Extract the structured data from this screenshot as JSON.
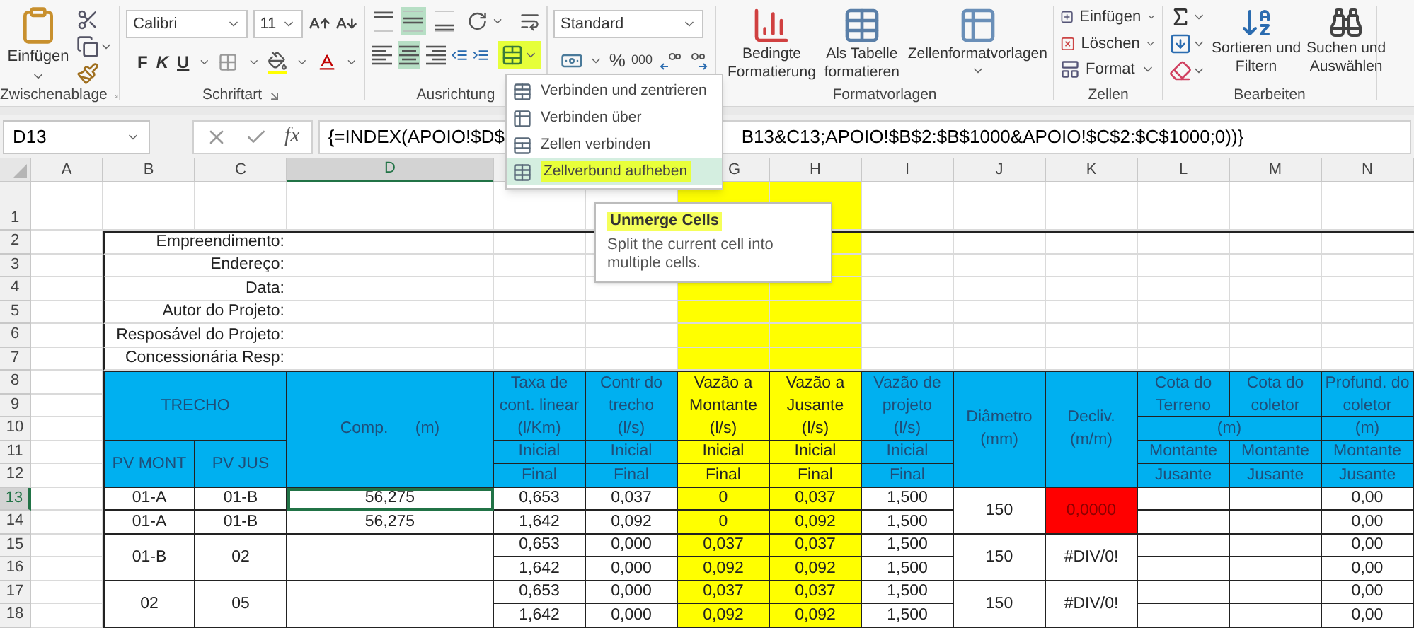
{
  "ribbon": {
    "clipboard": {
      "paste_label": "Einfügen",
      "group_label": "Zwischenablage"
    },
    "font": {
      "font_name": "Calibri",
      "font_size": "11",
      "style_buttons": [
        "F",
        "K",
        "U"
      ],
      "group_label": "Schriftart"
    },
    "alignment": {
      "vertical_align": [
        {
          "selected": false
        },
        {
          "selected": true
        },
        {
          "selected": false
        }
      ],
      "horizontal_align": [
        {
          "selected": false
        },
        {
          "selected": true
        },
        {
          "selected": false
        }
      ],
      "merge_highlighted": true,
      "group_label": "Ausrichtung"
    },
    "number": {
      "format": "Standard",
      "percent": "%",
      "thousands": "000"
    },
    "styles": {
      "buttons": [
        "Bedingte\nFormatierung",
        "Als Tabelle\nformatieren",
        "Zellenformatvorlagen"
      ],
      "group_label": "Formatvorlagen"
    },
    "cells": {
      "buttons": [
        "Einfügen",
        "Löschen",
        "Format"
      ],
      "group_label": "Zellen"
    },
    "editing": {
      "buttons": [
        "Sortieren und\nFiltern",
        "Suchen und\nAuswählen"
      ],
      "group_label": "Bearbeiten"
    }
  },
  "merge_menu": {
    "items": [
      {
        "label": "Verbinden und zentrieren",
        "selected": false
      },
      {
        "label": "Verbinden über",
        "selected": false
      },
      {
        "label": "Zellen verbinden",
        "selected": false
      },
      {
        "label": "Zellverbund aufheben",
        "selected": true
      }
    ]
  },
  "tooltip": {
    "title": "Unmerge Cells",
    "text": "Split the current cell into multiple cells."
  },
  "formula_bar": {
    "name_box": "D13",
    "fx": "fx",
    "formula_start": "{=INDEX(APOIO!$D$",
    "formula_end": "B13&C13;APOIO!$B$2:$B$1000&APOIO!$C$2:$C$1000;0))}"
  },
  "column_headers": [
    {
      "label": "A",
      "selected": false
    },
    {
      "label": "B",
      "selected": false
    },
    {
      "label": "C",
      "selected": false
    },
    {
      "label": "D",
      "selected": true
    },
    {
      "label": "G",
      "selected": false
    },
    {
      "label": "H",
      "selected": false
    },
    {
      "label": "I",
      "selected": false
    },
    {
      "label": "J",
      "selected": false
    },
    {
      "label": "K",
      "selected": false
    },
    {
      "label": "L",
      "selected": false
    },
    {
      "label": "M",
      "selected": false
    },
    {
      "label": "N",
      "selected": false
    }
  ],
  "row_headers": [
    {
      "label": "1",
      "selected": false
    },
    {
      "label": "2",
      "selected": false
    },
    {
      "label": "3",
      "selected": false
    },
    {
      "label": "4",
      "selected": false
    },
    {
      "label": "5",
      "selected": false
    },
    {
      "label": "6",
      "selected": false
    },
    {
      "label": "7",
      "selected": false
    },
    {
      "label": "8",
      "selected": false
    },
    {
      "label": "9",
      "selected": false
    },
    {
      "label": "10",
      "selected": false
    },
    {
      "label": "11",
      "selected": false
    },
    {
      "label": "12",
      "selected": false
    },
    {
      "label": "13",
      "selected": true
    },
    {
      "label": "14",
      "selected": false
    },
    {
      "label": "15",
      "selected": false
    },
    {
      "label": "16",
      "selected": false
    },
    {
      "label": "17",
      "selected": false
    },
    {
      "label": "18",
      "selected": false
    }
  ],
  "info_labels": [
    "Empreendimento:",
    "Endereço:",
    "Data:",
    "Autor do Projeto:",
    "Resposável do Projeto:",
    "Concessionária Resp:"
  ],
  "table_header": {
    "trecho": "TRECHO",
    "pv_mont": "PV MONT",
    "pv_jus": "PV JUS",
    "comp": "Comp.      (m)",
    "flow_columns": [
      {
        "title": "Taxa de\ncont. linear\n(l/Km)",
        "initial": "Inicial",
        "final": "Final",
        "highlighted": false
      },
      {
        "title": "Contr do\ntrecho\n(l/s)",
        "initial": "Inicial",
        "final": "Final",
        "highlighted": false
      },
      {
        "title": "Vazão a\nMontante\n(l/s)",
        "initial": "Inicial",
        "final": "Final",
        "highlighted": true
      },
      {
        "title": "Vazão a\nJusante\n(l/s)",
        "initial": "Inicial",
        "final": "Final",
        "highlighted": true
      },
      {
        "title": "Vazão de\nprojeto\n(l/s)",
        "initial": "Inicial",
        "final": "Final",
        "highlighted": false
      }
    ],
    "diametro": "Diâmetro\n(mm)",
    "decliv": "Decliv.\n(m/m)",
    "unit_shared": "(m)",
    "unit_depth": "(m)",
    "levels": [
      {
        "title": "Cota do\nTerreno",
        "top": "Montante",
        "bottom": "Jusante"
      },
      {
        "title": "Cota do\ncoletor",
        "top": "Montante",
        "bottom": "Jusante"
      },
      {
        "title": "Profund. do\ncoletor",
        "top": "Montante",
        "bottom": "Jusante"
      }
    ]
  },
  "sections": [
    {
      "kind": "split",
      "diametro": "150",
      "decliv": "0,0000",
      "alert": true,
      "lines": [
        {
          "pv_mont": "01-A",
          "pv_jus": "01-B",
          "comp": "56,275",
          "values": [
            "0,653",
            "0,037",
            "0",
            "0,037",
            "1,500"
          ],
          "profund": "0,00"
        },
        {
          "pv_mont": "01-A",
          "pv_jus": "01-B",
          "comp": "56,275",
          "values": [
            "1,642",
            "0,092",
            "0",
            "0,092",
            "1,500"
          ],
          "profund": "0,00"
        }
      ]
    },
    {
      "kind": "merged",
      "pv_mont": "01-B",
      "pv_jus": "02",
      "diametro": "150",
      "decliv": "#DIV/0!",
      "alert": false,
      "lines": [
        {
          "values": [
            "0,653",
            "0,000",
            "0,037",
            "0,037",
            "1,500"
          ],
          "profund": "0,00"
        },
        {
          "values": [
            "1,642",
            "0,000",
            "0,092",
            "0,092",
            "1,500"
          ],
          "profund": "0,00"
        }
      ]
    },
    {
      "kind": "merged",
      "pv_mont": "02",
      "pv_jus": "05",
      "diametro": "150",
      "decliv": "#DIV/0!",
      "alert": false,
      "lines": [
        {
          "values": [
            "0,653",
            "0,000",
            "0,037",
            "0,037",
            "1,500"
          ],
          "profund": "0,00"
        },
        {
          "values": [
            "1,642",
            "0,000",
            "0,092",
            "0,092",
            "1,500"
          ],
          "profund": "0,00"
        }
      ]
    }
  ]
}
